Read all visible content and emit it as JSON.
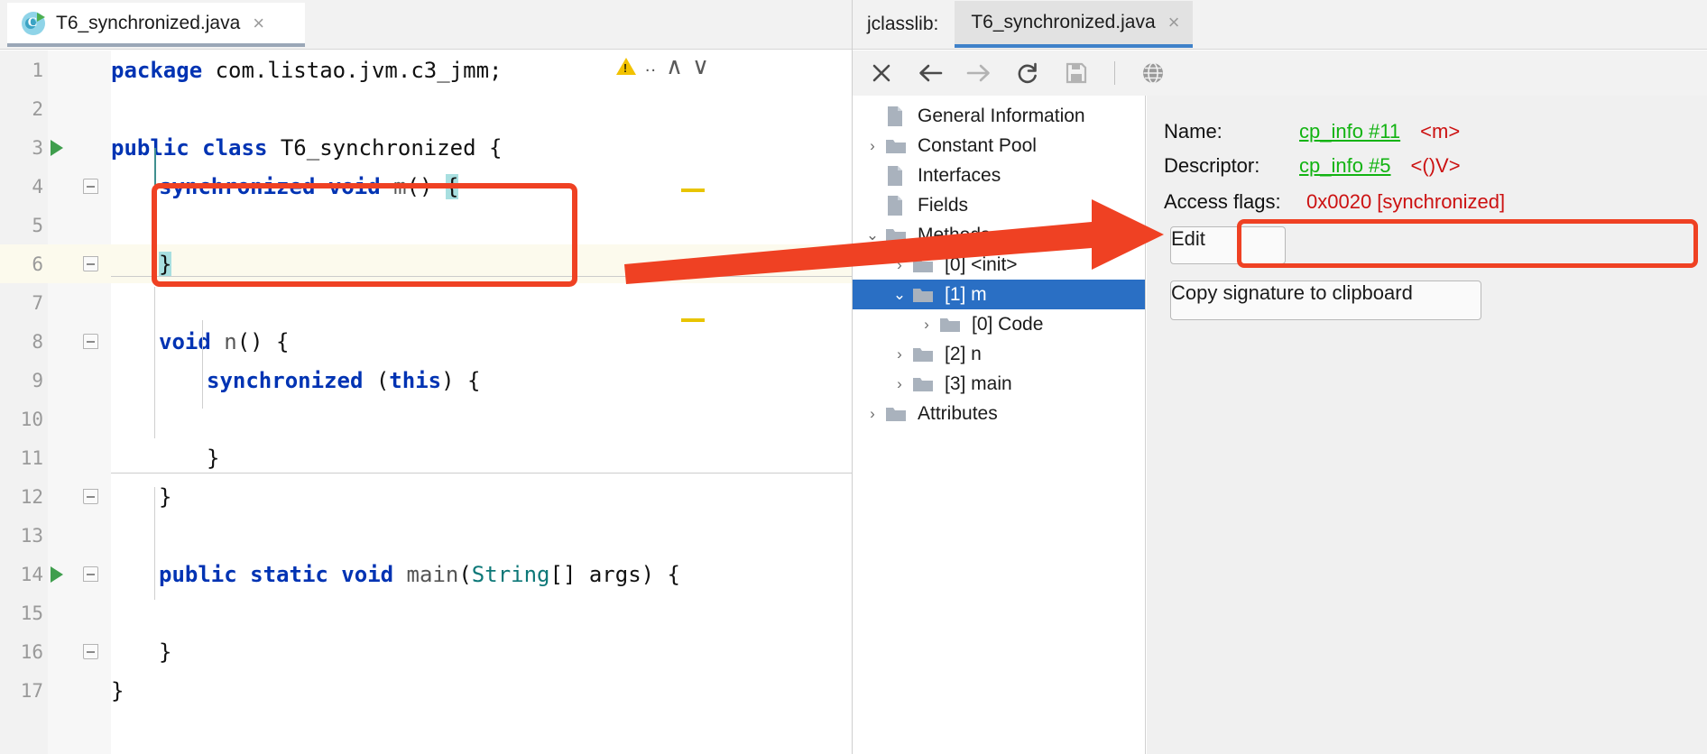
{
  "editor": {
    "tab": {
      "label": "T6_synchronized.java",
      "icon": "java-class-icon",
      "close": "×"
    },
    "inspection": {
      "dots": "..",
      "up": "∧",
      "down": "∨",
      "icon": "warning-triangle-icon"
    },
    "lines": [
      {
        "n": "1",
        "segments": [
          {
            "t": "package ",
            "c": "kw"
          },
          {
            "t": "com.listao.jvm.c3_jmm;",
            "c": "pl"
          }
        ],
        "indent": 0
      },
      {
        "n": "2",
        "segments": [],
        "indent": 0
      },
      {
        "n": "3",
        "segments": [
          {
            "t": "public class ",
            "c": "kw"
          },
          {
            "t": "T6_synchronized ",
            "c": "pl"
          },
          {
            "t": "{",
            "c": "pl"
          }
        ],
        "indent": 0,
        "run": true
      },
      {
        "n": "4",
        "segments": [
          {
            "t": "synchronized void ",
            "c": "kw"
          },
          {
            "t": "m",
            "c": "mth"
          },
          {
            "t": "() ",
            "c": "pl"
          },
          {
            "t": "{",
            "c": "hl"
          }
        ],
        "indent": 1,
        "fold": "top"
      },
      {
        "n": "5",
        "segments": [],
        "indent": 1
      },
      {
        "n": "6",
        "segments": [
          {
            "t": "}",
            "c": "hl"
          }
        ],
        "indent": 1,
        "fold": "bot",
        "highlight": true
      },
      {
        "n": "7",
        "segments": [],
        "indent": 0
      },
      {
        "n": "8",
        "segments": [
          {
            "t": "void ",
            "c": "kw"
          },
          {
            "t": "n",
            "c": "mth"
          },
          {
            "t": "() {",
            "c": "pl"
          }
        ],
        "indent": 1,
        "fold": "top"
      },
      {
        "n": "9",
        "segments": [
          {
            "t": "synchronized ",
            "c": "kw"
          },
          {
            "t": "(",
            "c": "pl"
          },
          {
            "t": "this",
            "c": "kw"
          },
          {
            "t": ") {",
            "c": "pl"
          }
        ],
        "indent": 2
      },
      {
        "n": "10",
        "segments": [],
        "indent": 2
      },
      {
        "n": "11",
        "segments": [
          {
            "t": "}",
            "c": "pl"
          }
        ],
        "indent": 2
      },
      {
        "n": "12",
        "segments": [
          {
            "t": "}",
            "c": "pl"
          }
        ],
        "indent": 1,
        "fold": "bot"
      },
      {
        "n": "13",
        "segments": [],
        "indent": 0
      },
      {
        "n": "14",
        "segments": [
          {
            "t": "public static void ",
            "c": "kw"
          },
          {
            "t": "main",
            "c": "mth"
          },
          {
            "t": "(",
            "c": "pl"
          },
          {
            "t": "String",
            "c": "tp"
          },
          {
            "t": "[] args) {",
            "c": "pl"
          }
        ],
        "indent": 1,
        "run": true,
        "fold": "top"
      },
      {
        "n": "15",
        "segments": [],
        "indent": 1
      },
      {
        "n": "16",
        "segments": [
          {
            "t": "}",
            "c": "pl"
          }
        ],
        "indent": 1,
        "fold": "bot"
      },
      {
        "n": "17",
        "segments": [
          {
            "t": "}",
            "c": "pl"
          }
        ],
        "indent": 0
      }
    ]
  },
  "tool_window": {
    "group_label": "jclasslib:",
    "tab_label": "T6_synchronized.java",
    "tab_close": "×",
    "toolbar": [
      {
        "name": "close-icon",
        "title": "Close"
      },
      {
        "name": "back-arrow-icon",
        "title": "Back"
      },
      {
        "name": "forward-arrow-icon",
        "title": "Forward"
      },
      {
        "name": "refresh-icon",
        "title": "Reload"
      },
      {
        "name": "save-icon",
        "title": "Save"
      },
      {
        "name": "globe-icon",
        "title": "Browse"
      }
    ],
    "tree": [
      {
        "label": "General Information",
        "icon": "file-icon",
        "twist": "",
        "depth": 0,
        "selected": false
      },
      {
        "label": "Constant Pool",
        "icon": "folder-icon",
        "twist": "›",
        "depth": 0,
        "selected": false
      },
      {
        "label": "Interfaces",
        "icon": "file-icon",
        "twist": "",
        "depth": 0,
        "selected": false
      },
      {
        "label": "Fields",
        "icon": "file-icon",
        "twist": "",
        "depth": 0,
        "selected": false
      },
      {
        "label": "Methods",
        "icon": "folder-icon",
        "twist": "⌄",
        "depth": 0,
        "selected": false
      },
      {
        "label": "[0] <init>",
        "icon": "folder-icon",
        "twist": "›",
        "depth": 1,
        "selected": false
      },
      {
        "label": "[1] m",
        "icon": "folder-icon",
        "twist": "⌄",
        "depth": 1,
        "selected": true
      },
      {
        "label": "[0] Code",
        "icon": "folder-icon",
        "twist": "›",
        "depth": 2,
        "selected": false
      },
      {
        "label": "[2] n",
        "icon": "folder-icon",
        "twist": "›",
        "depth": 1,
        "selected": false
      },
      {
        "label": "[3] main",
        "icon": "folder-icon",
        "twist": "›",
        "depth": 1,
        "selected": false
      },
      {
        "label": "Attributes",
        "icon": "folder-icon",
        "twist": "›",
        "depth": 0,
        "selected": false
      }
    ],
    "detail": {
      "name_label": "Name:",
      "name_link": "cp_info #11",
      "name_value": "<m>",
      "descriptor_label": "Descriptor:",
      "descriptor_link": "cp_info #5",
      "descriptor_value": "<()V>",
      "access_flags_label": "Access flags:",
      "access_flags_value": "0x0020 [synchronized]",
      "edit_button": "Edit",
      "copy_button": "Copy signature to clipboard"
    }
  },
  "annotations": {
    "colors": {
      "highlight_red": "#ef4123",
      "selection_blue": "#2a6fc4",
      "link_green": "#12b312",
      "value_red": "#cc1111",
      "keyword_blue": "#0033b3",
      "marker_yellow": "#e8c400",
      "code_highlight_cyan": "#a8dfe0"
    },
    "arrow": "right-arrow-annotation",
    "code_box": "code-highlight-box",
    "flags_box": "access-flags-highlight-box"
  }
}
